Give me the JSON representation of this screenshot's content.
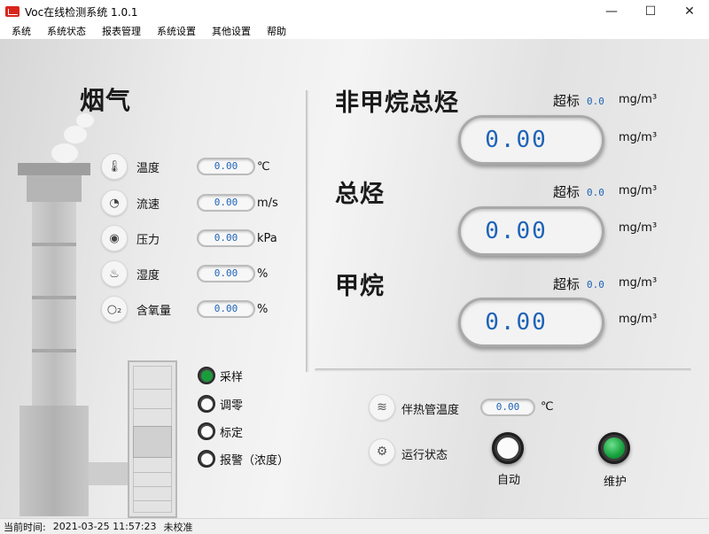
{
  "window": {
    "title": "Voc在线检测系统 1.0.1",
    "minimize": "—",
    "maximize": "☐",
    "close": "✕"
  },
  "menu": [
    "系统",
    "系统状态",
    "报表管理",
    "系统设置",
    "其他设置",
    "帮助"
  ],
  "flue_gas": {
    "title": "烟气",
    "params": [
      {
        "label": "温度",
        "value": "0.00",
        "unit": "℃",
        "icon": "thermometer-icon"
      },
      {
        "label": "流速",
        "value": "0.00",
        "unit": "m/s",
        "icon": "gauge-icon"
      },
      {
        "label": "压力",
        "value": "0.00",
        "unit": "kPa",
        "icon": "pressure-icon"
      },
      {
        "label": "湿度",
        "value": "0.00",
        "unit": "%",
        "icon": "humidity-icon"
      },
      {
        "label": "含氧量",
        "value": "0.00",
        "unit": "%",
        "icon": "oxygen-icon"
      }
    ]
  },
  "gases": [
    {
      "title": "非甲烷总烃",
      "exceed_label": "超标",
      "exceed_value": "0.0",
      "unit_top": "mg/m³",
      "value": "0.00",
      "unit": "mg/m³"
    },
    {
      "title": "总烃",
      "exceed_label": "超标",
      "exceed_value": "0.0",
      "unit_top": "mg/m³",
      "value": "0.00",
      "unit": "mg/m³"
    },
    {
      "title": "甲烷",
      "exceed_label": "超标",
      "exceed_value": "0.0",
      "unit_top": "mg/m³",
      "value": "0.00",
      "unit": "mg/m³"
    }
  ],
  "modes": [
    {
      "label": "采样",
      "active": true
    },
    {
      "label": "调零",
      "active": false
    },
    {
      "label": "标定",
      "active": false
    },
    {
      "label": "报警（浓度）",
      "active": false
    }
  ],
  "heater": {
    "label": "伴热管温度",
    "value": "0.00",
    "unit": "℃"
  },
  "run_state": {
    "label": "运行状态",
    "auto_label": "自动",
    "maintain_label": "维护",
    "auto_on": false,
    "maintain_on": true
  },
  "statusbar": {
    "time_label": "当前时间:",
    "time_value": "2021-03-25 11:57:23",
    "calibration": "未校准"
  },
  "colors": {
    "value_blue": "#1e63b8",
    "active_green": "#1a9b3c"
  }
}
